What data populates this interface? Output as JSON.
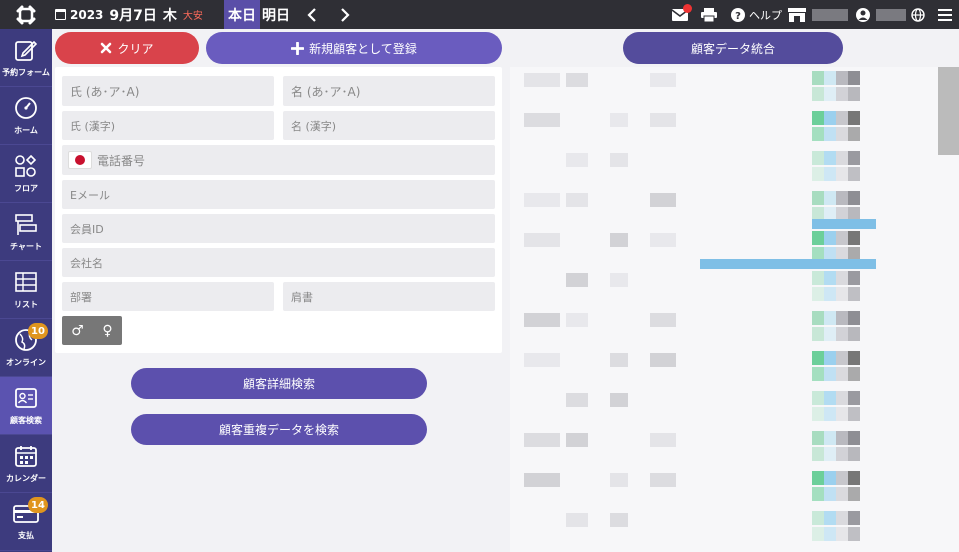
{
  "topbar": {
    "year": "2023",
    "month_day": "9月7日",
    "weekday": "木",
    "rokuyo": "大安",
    "today_label": "本日",
    "tomorrow_label": "明日",
    "help_label": "ヘルプ",
    "mail_badge": "1"
  },
  "sidebar": {
    "items": [
      {
        "label": "予約フォーム",
        "icon": "edit-icon"
      },
      {
        "label": "ホーム",
        "icon": "gauge-icon"
      },
      {
        "label": "フロア",
        "icon": "floor-icon"
      },
      {
        "label": "チャート",
        "icon": "chart-icon"
      },
      {
        "label": "リスト",
        "icon": "list-icon"
      },
      {
        "label": "オンライン",
        "icon": "globe-icon",
        "badge": "10"
      },
      {
        "label": "顧客検索",
        "icon": "customer-card-icon"
      },
      {
        "label": "カレンダー",
        "icon": "calendar-icon"
      },
      {
        "label": "支払",
        "icon": "payment-card-icon",
        "badge": "14"
      }
    ]
  },
  "actions": {
    "clear_label": "クリア",
    "register_label": "新規顧客として登録",
    "merge_label": "顧客データ統合",
    "detail_search_label": "顧客詳細検索",
    "dup_search_label": "顧客重複データを検索"
  },
  "form": {
    "last_kana_placeholder": "氏 (あ･ア･A)",
    "first_kana_placeholder": "名 (あ･ア･A)",
    "last_kanji_placeholder": "氏 (漢字)",
    "first_kanji_placeholder": "名 (漢字)",
    "phone_placeholder": "電話番号",
    "email_placeholder": "Eメール",
    "member_id_placeholder": "会員ID",
    "company_placeholder": "会社名",
    "department_placeholder": "部署",
    "title_placeholder": "肩書",
    "male_symbol": "♂",
    "female_symbol": "♀"
  },
  "colors": {
    "accent": "#5c50ad",
    "danger": "#d9434b",
    "sidebar": "#3d3b7e",
    "topbar": "#2f2f35",
    "badge": "#e0951e"
  }
}
